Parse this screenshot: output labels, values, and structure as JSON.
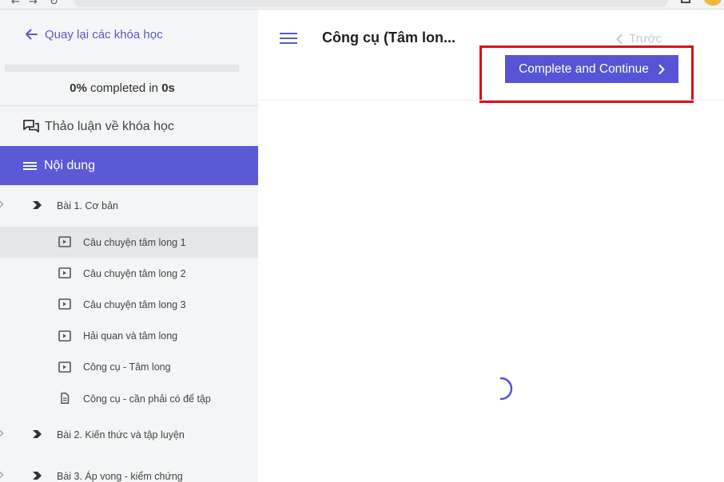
{
  "browser": {
    "back_glyph": "←",
    "forward_glyph": "→",
    "reload_glyph": "↻"
  },
  "sidebar": {
    "back_label": "Quay lại các khóa học",
    "progress": {
      "percent_text": "0%",
      "middle_text": " completed in ",
      "time_text": "0s",
      "fraction": 0
    },
    "discussion_label": "Thảo luận về khóa học",
    "content_label": "Nội dung",
    "sections": [
      {
        "label": "Bài 1. Cơ bản",
        "lessons": [
          {
            "label": "Câu chuyện tâm long 1",
            "icon": "video-icon",
            "active": true
          },
          {
            "label": "Câu chuyện tâm long 2",
            "icon": "video-icon",
            "active": false
          },
          {
            "label": "Câu chuyện tâm long 3",
            "icon": "video-icon",
            "active": false
          },
          {
            "label": "Hải quan và tâm long",
            "icon": "video-icon",
            "active": false
          },
          {
            "label": "Công cụ - Tâm long",
            "icon": "video-icon",
            "active": false
          },
          {
            "label": "Công cụ - cần phải có để tập",
            "icon": "document-icon",
            "active": false
          }
        ]
      },
      {
        "label": "Bài 2. Kiến thức và tập luyện"
      },
      {
        "label": "Bài 3. Áp vong - kiểm chứng"
      }
    ]
  },
  "header": {
    "title": "Công cụ (Tâm lon...",
    "prev_label": "Trước",
    "complete_label": "Complete and Continue"
  },
  "colors": {
    "accent": "#5c59d6",
    "annotation": "#d90f17",
    "sidebar_bg": "#f4f5f6"
  }
}
